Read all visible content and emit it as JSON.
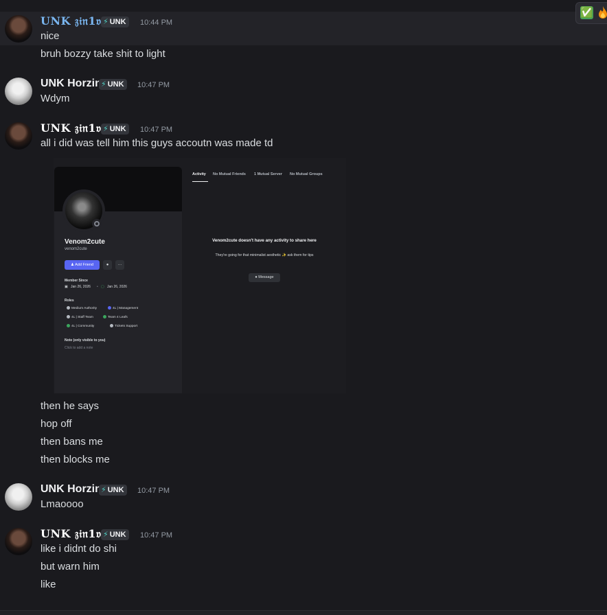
{
  "reactions": {
    "first": "✅",
    "second": "🔥"
  },
  "server_tag": {
    "icon": "⚡",
    "text": "UNK"
  },
  "messages": [
    {
      "author": "UNK 𝔷𝔦𝔫1𝔳",
      "time": "10:44 PM",
      "lines": [
        "nice",
        "bruh bozzy take shit to light"
      ]
    },
    {
      "author": "UNK Horzin",
      "time": "10:47 PM",
      "lines": [
        "Wdym"
      ]
    },
    {
      "author": "UNK 𝔷𝔦𝔫1𝔳",
      "time": "10:47 PM",
      "lines": [
        "all i did was tell him this guys accoutn was made td"
      ],
      "after_image_lines": [
        "then he says",
        "hop off",
        "then bans me",
        "then blocks me"
      ]
    },
    {
      "author": "UNK Horzin",
      "time": "10:47 PM",
      "lines": [
        "Lmaoooo"
      ]
    },
    {
      "author": "UNK 𝔷𝔦𝔫1𝔳",
      "time": "10:47 PM",
      "lines": [
        "like i didnt do shi",
        "but warn him",
        "like"
      ]
    }
  ],
  "attachment": {
    "profile": {
      "display_name": "Venom2cute",
      "username": "venom2cute",
      "add_friend_label": "Add Friend",
      "more_label": "···",
      "member_since_label": "Member Since",
      "member_since_discord": "Jan 26, 2026",
      "member_since_server": "Jan 26, 2026",
      "roles_label": "Roles",
      "roles": [
        {
          "name": "Medium Authority",
          "color": "#b5bac1"
        },
        {
          "name": "4L | Management",
          "color": "#5865f2"
        },
        {
          "name": "4L | Staff Team",
          "color": "#b5bac1"
        },
        {
          "name": "Team 4 Leafs",
          "color": "#3ba55d"
        },
        {
          "name": "4L | Community",
          "color": "#3ba55d"
        },
        {
          "name": "Tickets Support",
          "color": "#b5bac1"
        }
      ],
      "note_label": "Note (only visible to you)",
      "note_placeholder": "Click to add a note"
    },
    "tabs": [
      "Activity",
      "No Mutual Friends",
      "1 Mutual Server",
      "No Mutual Groups"
    ],
    "empty_title": "Venom2cute doesn't have any activity to share here",
    "empty_subtitle": "They're going for that minimalist aesthetic ✨ ask them for tips",
    "message_button": "Message"
  },
  "colors": {
    "background": "#1a1a1e",
    "accent": "#5865f2",
    "zin_name_blue": "#7ab6f0"
  }
}
